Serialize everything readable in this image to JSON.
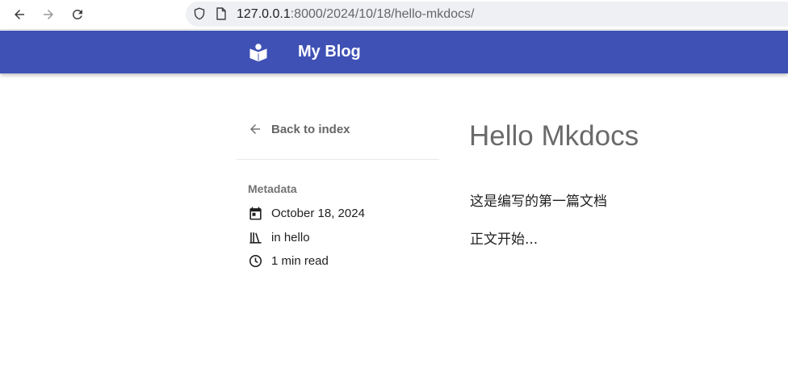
{
  "browser": {
    "url_host": "127.0.0.1",
    "url_path": ":8000/2024/10/18/hello-mkdocs/",
    "icons": [
      "arrow-left-icon",
      "arrow-right-icon",
      "reload-icon",
      "shield-icon",
      "page-icon"
    ]
  },
  "header": {
    "title": "My Blog",
    "logo_icon": "book-reader-icon",
    "background": "#3f51b5"
  },
  "sidebar": {
    "back_label": "Back to index",
    "metadata_heading": "Metadata",
    "date": "October 18, 2024",
    "category": "in hello",
    "read_time": "1 min read"
  },
  "article": {
    "title": "Hello Mkdocs",
    "paragraphs": [
      "这是编写的第一篇文档",
      "正文开始..."
    ]
  }
}
